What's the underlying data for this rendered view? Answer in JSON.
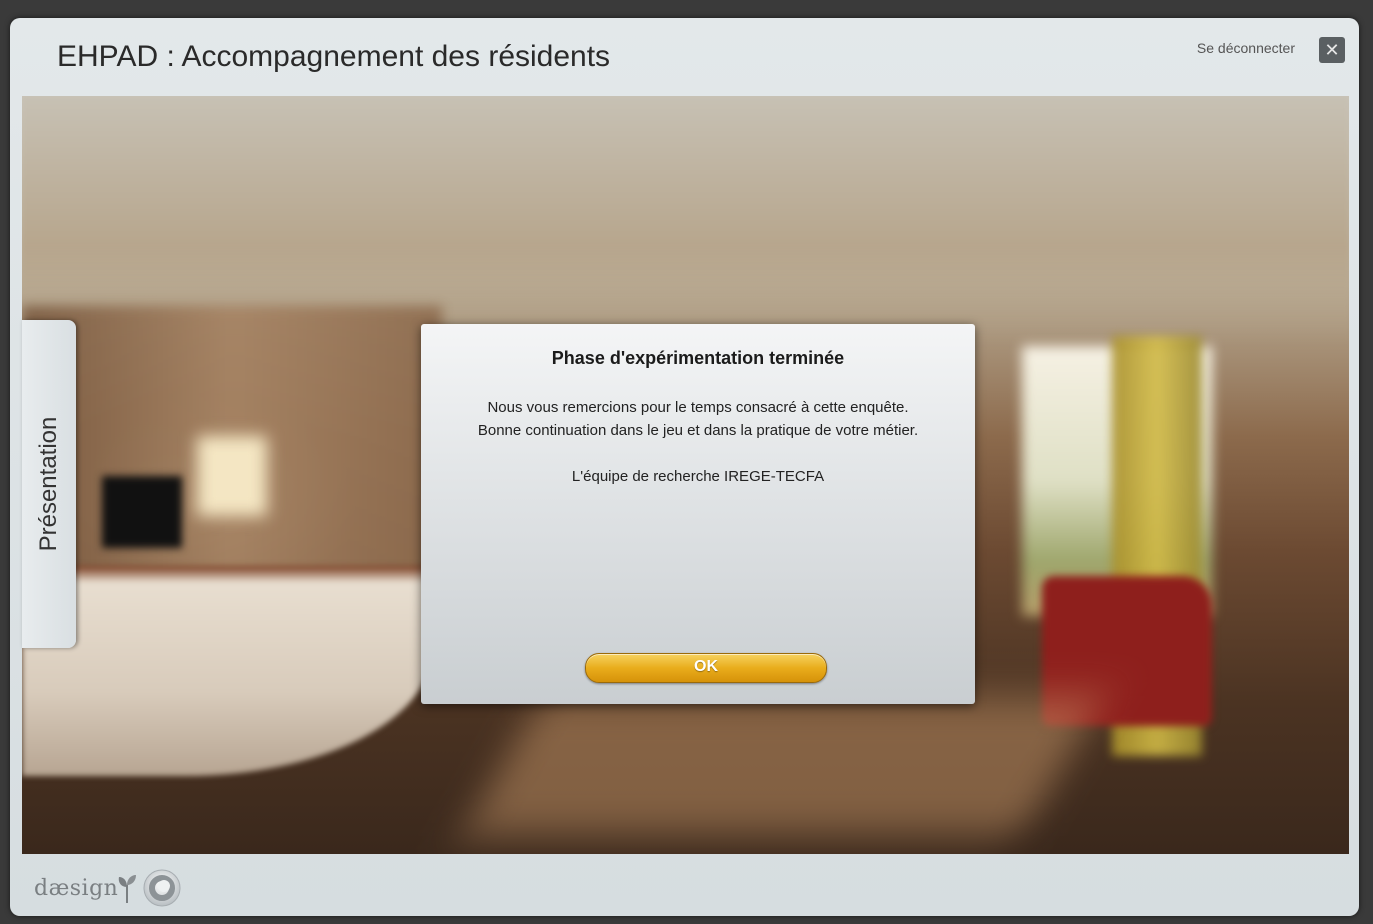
{
  "header": {
    "title": "EHPAD : Accompagnement des résidents",
    "logout_label": "Se déconnecter",
    "close_glyph": "✕"
  },
  "sidebar": {
    "tab_label": "Présentation"
  },
  "dialog": {
    "title": "Phase d'expérimentation terminée",
    "message_line1": "Nous vous remercions pour le temps consacré à cette enquête.",
    "message_line2": "Bonne continuation dans le jeu et dans la pratique de votre métier.",
    "signature": "L'équipe de recherche IREGE-TECFA",
    "ok_label": "OK"
  },
  "footer": {
    "brand_text": "dæsign",
    "brand_icons": [
      "sprout-icon",
      "ring-logo-icon"
    ]
  },
  "colors": {
    "ok_button": "#e9ad1c",
    "close_button": "#5a5f62",
    "frame": "#dde3e6"
  }
}
